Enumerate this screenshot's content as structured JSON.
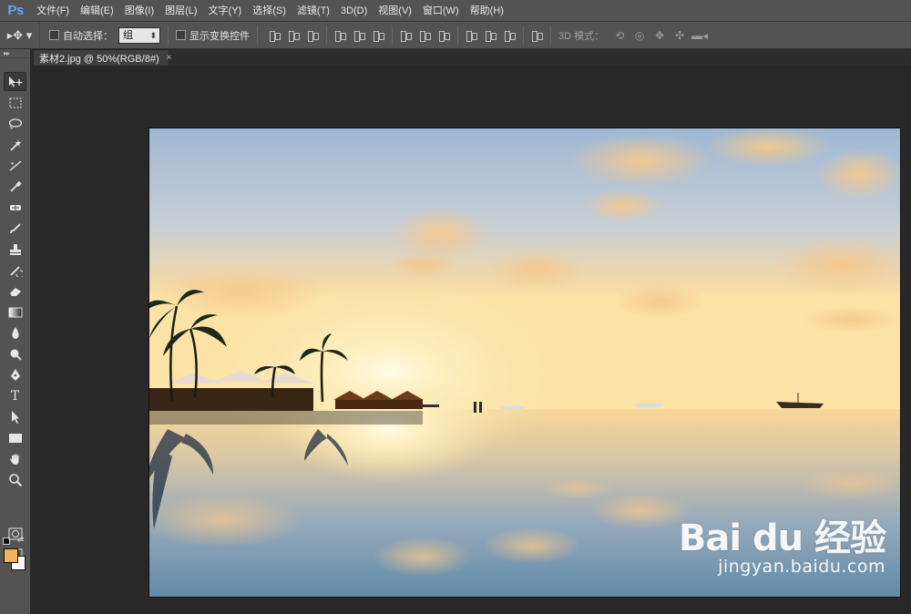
{
  "app": {
    "logo": "Ps"
  },
  "menu": [
    "文件(F)",
    "编辑(E)",
    "图像(I)",
    "图层(L)",
    "文字(Y)",
    "选择(S)",
    "滤镜(T)",
    "3D(D)",
    "视图(V)",
    "窗口(W)",
    "帮助(H)"
  ],
  "options": {
    "tool_arrow": "▸✥ ▾",
    "auto_select_label": "自动选择：",
    "auto_select_value": "组",
    "show_transform_label": "显示变换控件",
    "mode3d_label": "3D 模式："
  },
  "document": {
    "tab_title": "素材2.jpg @ 50%(RGB/8#)",
    "close_glyph": "×"
  },
  "colors": {
    "foreground": "#f0b45c",
    "background": "#ffffff"
  },
  "tools": [
    "move-tool",
    "marquee-tool",
    "lasso-tool",
    "magic-wand-tool",
    "crop-tool",
    "eyedropper-tool",
    "healing-tool",
    "brush-tool",
    "clone-stamp-tool",
    "history-brush-tool",
    "eraser-tool",
    "gradient-tool",
    "blur-tool",
    "dodge-tool",
    "pen-tool",
    "type-tool",
    "path-selection-tool",
    "rectangle-tool",
    "hand-tool",
    "zoom-tool"
  ],
  "watermark": {
    "logo_text": "Bai du 经验",
    "url": "jingyan.baidu.com"
  }
}
